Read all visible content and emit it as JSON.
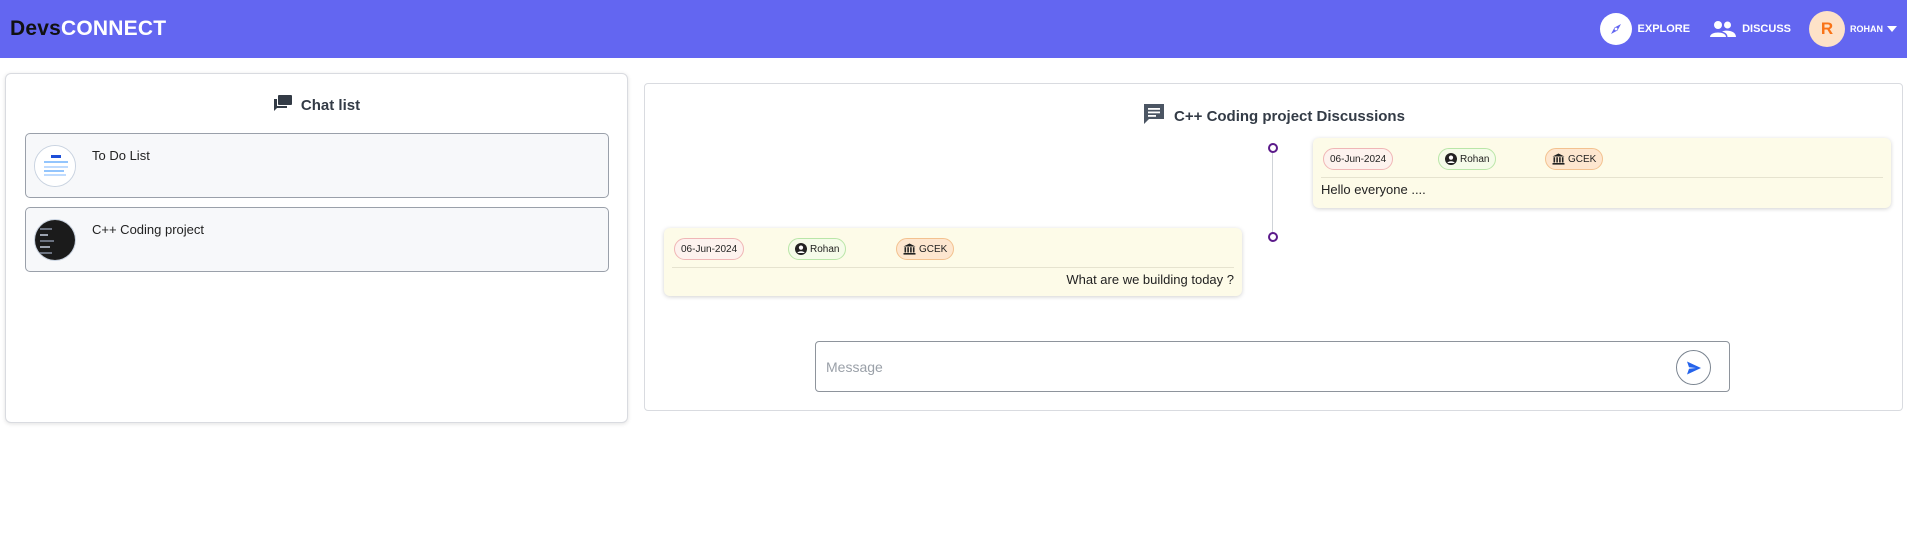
{
  "navbar": {
    "brand_part1": "Devs",
    "brand_part2": "CONNECT",
    "explore_label": "EXPLORE",
    "discuss_label": "DISCUSS",
    "user_initial": "R",
    "user_name": "ROHAN"
  },
  "chat_list": {
    "title": "Chat list",
    "items": [
      {
        "name": "To Do List"
      },
      {
        "name": "C++ Coding project"
      }
    ]
  },
  "discussion": {
    "title": "C++ Coding project Discussions",
    "messages": [
      {
        "date": "06-Jun-2024",
        "user": "Rohan",
        "org": "GCEK",
        "text": "Hello everyone ...."
      },
      {
        "date": "06-Jun-2024",
        "user": "Rohan",
        "org": "GCEK",
        "text": "What are we building today ?"
      }
    ],
    "input_placeholder": "Message"
  },
  "colors": {
    "navbar": "#6366f1",
    "avatar_bg": "#fde2c8",
    "avatar_text": "#f97316",
    "message_bg": "#fdfbe8",
    "timeline_dot": "#5b1a8a"
  },
  "icons": {
    "explore": "compass-icon",
    "discuss": "users-icon",
    "chat_list": "chat-bubbles-icon",
    "discussion": "message-icon",
    "user_chip": "user-circle-icon",
    "org_chip": "institution-icon",
    "send": "send-icon"
  }
}
